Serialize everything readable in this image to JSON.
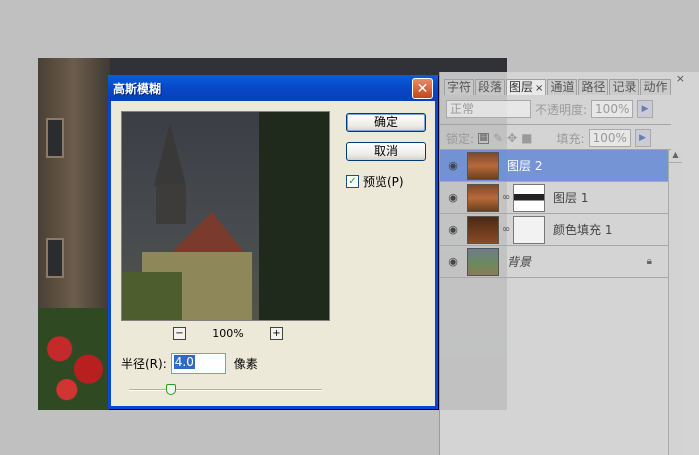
{
  "dialog": {
    "title": "高斯模糊",
    "close_glyph": "✕",
    "ok_label": "确定",
    "cancel_label": "取消",
    "preview_label": "预览(P)",
    "preview_checked": true,
    "zoom_out_glyph": "−",
    "zoom_in_glyph": "+",
    "zoom_level": "100%",
    "radius_label": "半径(R):",
    "radius_value": "4.0",
    "radius_unit": "像素",
    "slider_fraction": 0.22
  },
  "layers_panel": {
    "close_glyph": "×",
    "tabs": [
      "字符",
      "段落",
      "图层",
      "通道",
      "路径",
      "历史记录",
      "动作"
    ],
    "tab_display": [
      "字符",
      "段落",
      "图层",
      "通道",
      "路径",
      "历史记录",
      "动作"
    ],
    "tab_labels_visible": [
      "字符",
      "段落",
      "图层",
      "通道",
      "路径",
      "记录",
      "动作"
    ],
    "active_tab": "图层",
    "blend_mode": "正常",
    "opacity_label": "不透明度:",
    "opacity_value": "100%",
    "lock_label": "锁定:",
    "fill_label": "填充:",
    "fill_value": "100%",
    "layers": [
      {
        "name": "图层 2",
        "selected": true
      },
      {
        "name": "图层 1",
        "selected": false
      },
      {
        "name": "颜色填充 1",
        "selected": false
      },
      {
        "name": "背景",
        "selected": false
      }
    ]
  },
  "colors": {
    "title_bar": "#0648c8",
    "selected_layer": "#6a8dd6",
    "dialog_bg": "#ece9d8"
  }
}
